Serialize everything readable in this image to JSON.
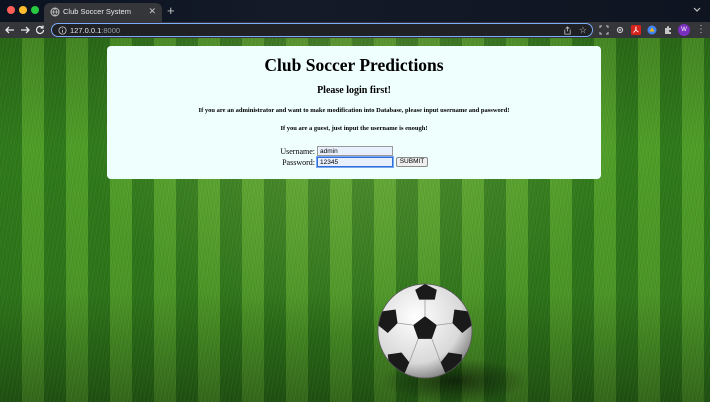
{
  "browser": {
    "tab_title": "Club Soccer System",
    "url_host": "127.0.0.1",
    "url_port": ":8000",
    "profile_initial": "W"
  },
  "page": {
    "heading": "Club Soccer Predictions",
    "subheading": "Please login first!",
    "admin_note": "If you are an administrator and want to make modification into Database, please input username and password!",
    "guest_note": "If you are a guest, just input the username is enough!",
    "form": {
      "username_label": "Username:",
      "username_value": "admin",
      "password_label": "Password:",
      "password_value": "12345",
      "submit_label": "SUBMIT"
    }
  },
  "colors": {
    "panel_bg": "#effffd",
    "accent": "#7cacf8",
    "grass_dark": "#2f7a1a",
    "grass_light": "#4f9e28"
  },
  "icons": [
    "globe-icon",
    "close-icon",
    "plus-icon",
    "back-icon",
    "forward-icon",
    "reload-icon",
    "info-icon",
    "share-icon",
    "star-icon",
    "extension-icon",
    "kebab-menu-icon",
    "soccer-ball"
  ]
}
